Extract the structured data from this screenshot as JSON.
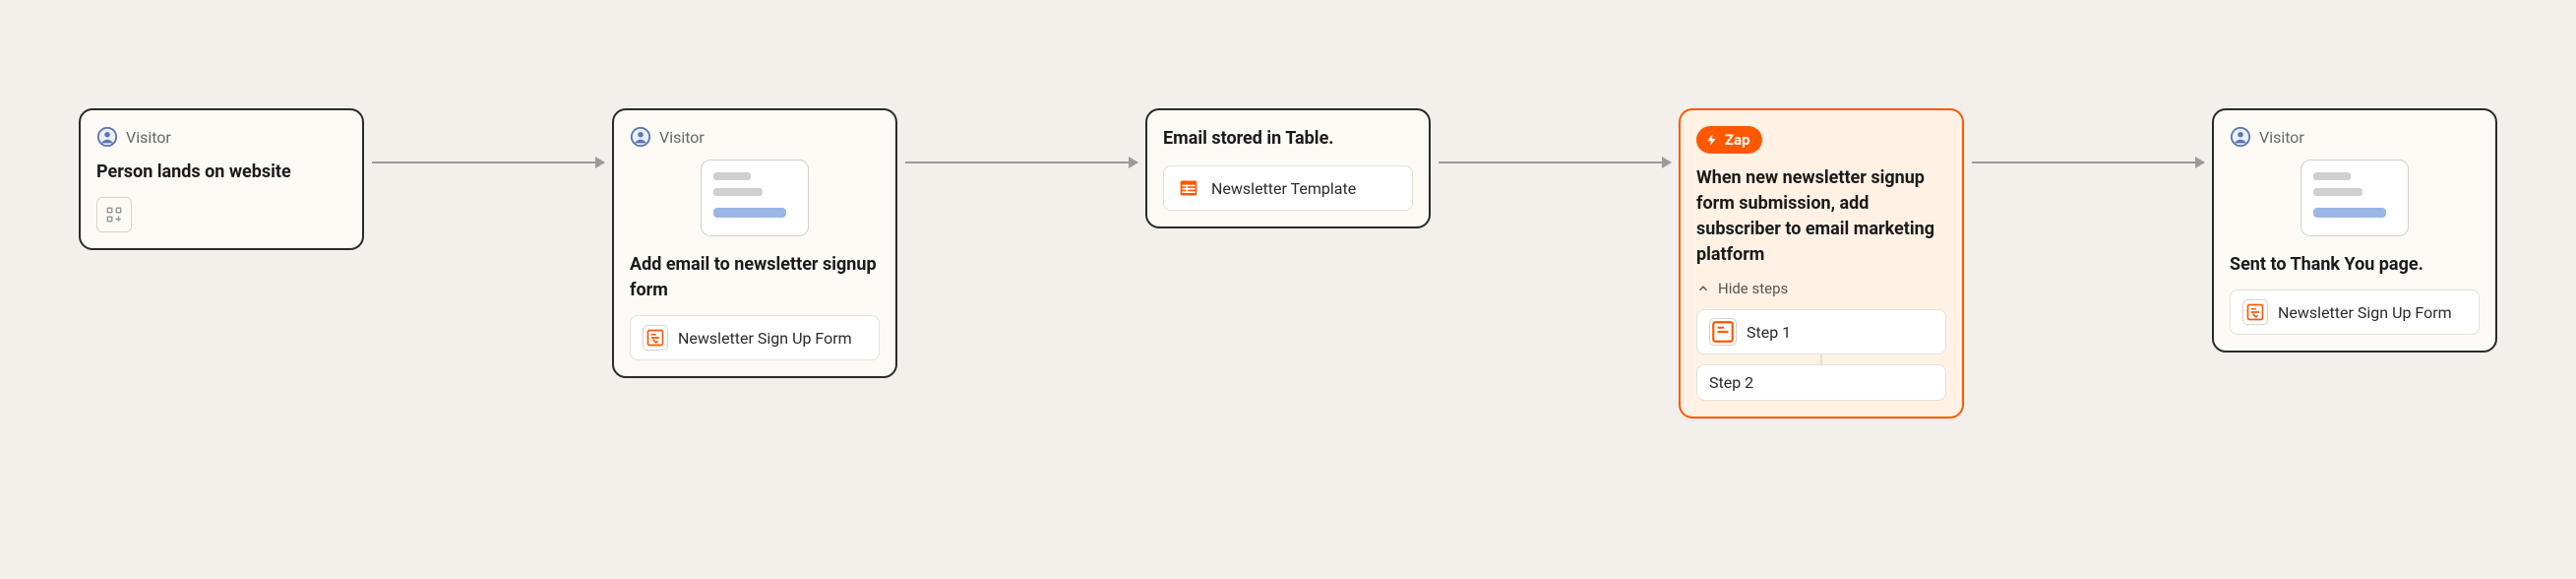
{
  "nodes": [
    {
      "role_label": "Visitor",
      "title": "Person lands on website"
    },
    {
      "role_label": "Visitor",
      "title": "Add email to newsletter signup form",
      "tag": "Newsletter Sign Up Form"
    },
    {
      "title": "Email stored in Table.",
      "tag": "Newsletter Template"
    },
    {
      "zap_label": "Zap",
      "title": "When new newsletter signup form submission, add subscriber to email marketing platform",
      "toggle": "Hide steps",
      "steps": [
        "Step 1",
        "Step 2"
      ]
    },
    {
      "role_label": "Visitor",
      "title": "Sent to Thank You page.",
      "tag": "Newsletter Sign Up Form"
    }
  ]
}
